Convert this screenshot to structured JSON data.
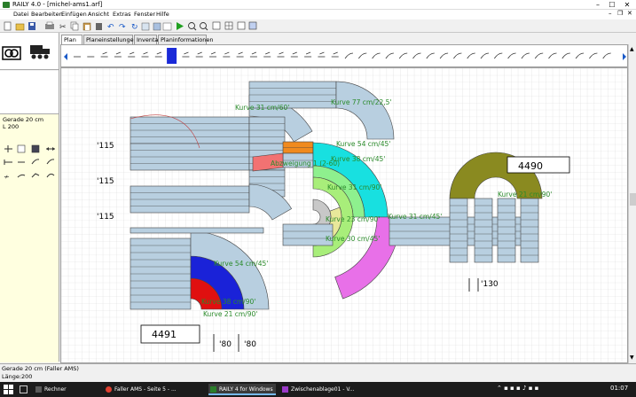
{
  "window": {
    "title": "RAILY 4.0 - [michel-ams1.arf]"
  },
  "menu": [
    "Datei",
    "Bearbeiten",
    "Einfügen",
    "Ansicht",
    "Extras",
    "Fenster",
    "Hilfe"
  ],
  "tabs": [
    "Plan",
    "Planeinstellungen",
    "Inventar",
    "Planinformationen"
  ],
  "left_panel": {
    "item_name": "Gerade 20 cm",
    "item_length": "L 200"
  },
  "status": {
    "line1": "Gerade 20 cm (Faller AMS)",
    "line2": "Länge:200"
  },
  "canvas": {
    "labels": [
      "Kurve 31 cm/60'",
      "Kurve 77 cm/22,5'",
      "Kurve 54 cm/45'",
      "Abzweigung 1 (2-60)",
      "Kurve 38 cm/45'",
      "Kurve 31 cm/90'",
      "Kurve 23 cm/90'",
      "Kurve 31 cm/45'",
      "Kurve 30 cm/45'",
      "Kurve 21 cm/90'",
      "Kurve 54 cm/45'",
      "Kurve 38 cm/90'",
      "Kurve 21 cm/90'"
    ],
    "dimensions": [
      "115",
      "115",
      "115",
      "130",
      "80",
      "80"
    ],
    "boxes": [
      "4490",
      "4491"
    ]
  },
  "taskbar": {
    "items": [
      "Rechner",
      "Faller AMS - Seite 5 - ...",
      "RAILY 4 for Windows",
      "Zwischenablage01 - V..."
    ],
    "clock": "01:07"
  },
  "colors": {
    "track": "#b8cfe0",
    "grid": "#d9d9d9",
    "label": "#2a8a2a"
  }
}
